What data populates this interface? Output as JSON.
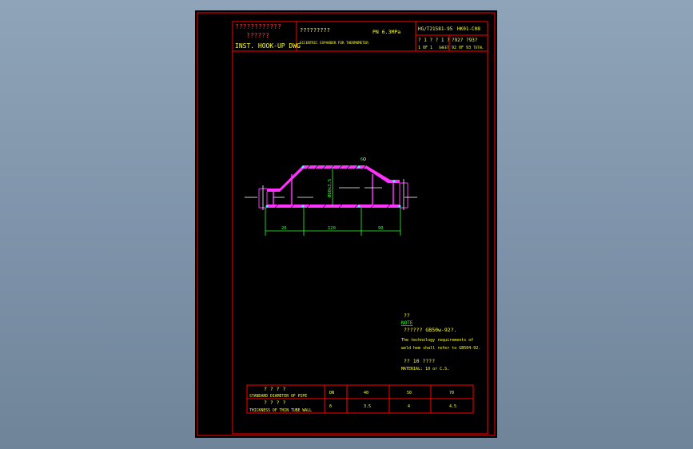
{
  "title_block": {
    "cn_org_line1": "????????????",
    "cn_org_line2": "??????",
    "hookup_label": "INST. HOOK-UP DWG",
    "cn_title": "?????????",
    "pn_label": "PN 6.3MPa",
    "en_title": "ECCENTRIC EXPANDER FOR THERMOMETER",
    "std_number": "HG/T21581-95",
    "drawing_no": "HK01-C08",
    "cn_sheet_label": "? 1 ? ? 1 ?",
    "sheet_of": "1 OF 1",
    "sheet_word": "SHEET",
    "cn_page_label": "?92? ?93?",
    "page_of": "92 OF 93",
    "total_word": "TOTAL"
  },
  "dimensions": {
    "diameter_label": "Ø60x3.5",
    "dim_1": "20",
    "dim_2": "120",
    "dim_3": "90",
    "weld_mark": "6"
  },
  "notes": {
    "cn_note_heading": "??",
    "note_heading": "NOTE",
    "cn_note_text": "??????  GB50w-92?.",
    "note_line1": "The technology requirements of",
    "note_line2": "weld hem shall refer to GB504-92.",
    "cn_material": "?? 10 ????",
    "material": "MATERIAL: 10 or C.S."
  },
  "spec_table": {
    "row1_cn": "? ? ? ?",
    "row1_label": "STANDARD DIAMETER OF PIPE",
    "row1_unit": "DN",
    "row1_values": [
      "40",
      "50",
      "70"
    ],
    "row2_cn": "? ? ? ?",
    "row2_label": "THICKNESS OF THIN TUBE WALL",
    "row2_unit": "δ",
    "row2_values": [
      "3.5",
      "4",
      "4.5"
    ]
  },
  "colors": {
    "frame": "#ff0000",
    "text_yellow": "#ffff33",
    "text_green": "#33ff33",
    "section_magenta": "#ff33ff",
    "dimension_green": "#33ff33",
    "center_white": "#ffffff"
  }
}
